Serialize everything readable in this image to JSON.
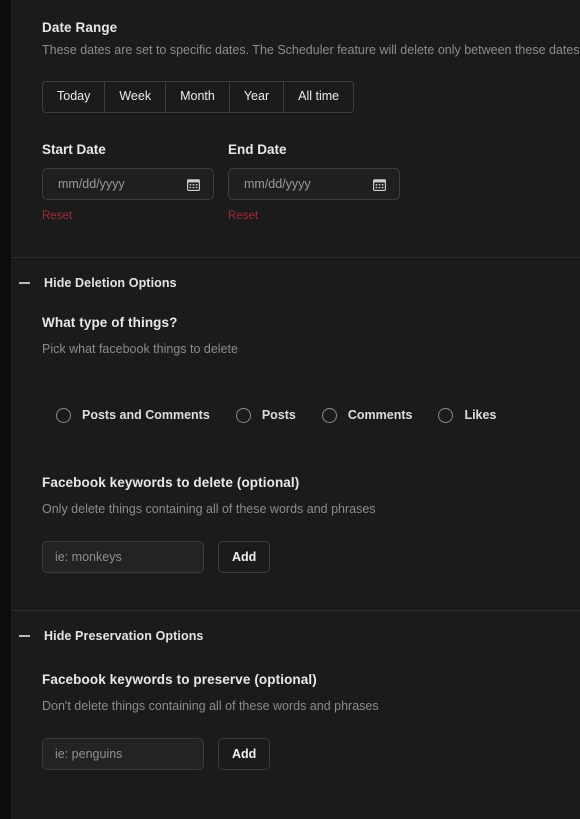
{
  "colors": {
    "page_background": "#0d0d0d",
    "panel_background": "#1b1b1b",
    "divider": "#2c2c2c",
    "heading_text": "#e8e8e8",
    "muted_text": "#8c8c8c",
    "reset_link": "#a12c3c",
    "input_background": "#232323",
    "border": "#3d3d3d"
  },
  "date_range": {
    "heading": "Date Range",
    "description": "These dates are set to specific dates. The Scheduler feature will delete only between these dates.",
    "presets": [
      {
        "label": "Today"
      },
      {
        "label": "Week"
      },
      {
        "label": "Month"
      },
      {
        "label": "Year"
      },
      {
        "label": "All time"
      }
    ],
    "start_date": {
      "label": "Start Date",
      "placeholder": "mm/dd/yyyy",
      "value": "",
      "reset_label": "Reset",
      "icon": "calendar-icon"
    },
    "end_date": {
      "label": "End Date",
      "placeholder": "mm/dd/yyyy",
      "value": "",
      "reset_label": "Reset",
      "icon": "calendar-icon"
    }
  },
  "deletion_options": {
    "toggle_label": "Hide Deletion Options",
    "toggle_icon": "minus-icon",
    "type_heading": "What type of things?",
    "type_description": "Pick what facebook things to delete",
    "radios": [
      {
        "label": "Posts and Comments",
        "selected": false
      },
      {
        "label": "Posts",
        "selected": false
      },
      {
        "label": "Comments",
        "selected": false
      },
      {
        "label": "Likes",
        "selected": false
      }
    ],
    "keywords": {
      "heading": "Facebook keywords to delete (optional)",
      "description": "Only delete things containing all of these words and phrases",
      "placeholder": "ie: monkeys",
      "value": "",
      "add_label": "Add"
    }
  },
  "preservation_options": {
    "toggle_label": "Hide Preservation Options",
    "toggle_icon": "minus-icon",
    "keywords": {
      "heading": "Facebook keywords to preserve (optional)",
      "description": "Don't delete things containing all of these words and phrases",
      "placeholder": "ie: penguins",
      "value": "",
      "add_label": "Add"
    }
  }
}
